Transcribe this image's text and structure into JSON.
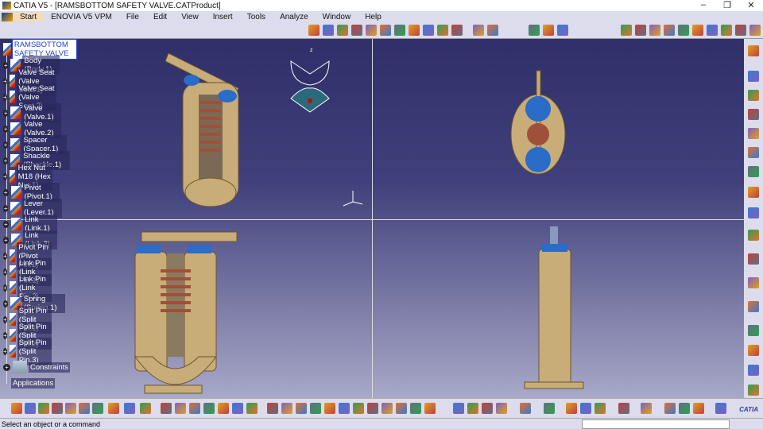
{
  "window": {
    "title": "CATIA V5 - [RAMSBOTTOM SAFETY VALVE.CATProduct]",
    "controls": [
      "–",
      "❐",
      "✕"
    ]
  },
  "menu": [
    "Start",
    "ENOVIA V5 VPM",
    "File",
    "Edit",
    "View",
    "Insert",
    "Tools",
    "Analyze",
    "Window",
    "Help"
  ],
  "tree": {
    "root": "RAMSBOTTOM SAFETY VALVE",
    "items": [
      "Body (Body.1)",
      "Valve Seat (Valve Seat.1)",
      "Valve Seat (Valve Seat.2)",
      "Valve (Valve.1)",
      "Valve (Valve.2)",
      "Spacer (Spacer.1)",
      "Shackle (Shackle.1)",
      "Hex Nut M18 (Hex Nut.1)",
      "Pivot (Pivot.1)",
      "Lever (Lever.1)",
      "Link (Link.1)",
      "Link (Link.2)",
      "Pivot Pin (Pivot Pin.1)",
      "Link Pin (Link Pin.1)",
      "Link Pin (Link Pin.2)",
      "Spring (Spring.1)",
      "Split Pin (Split Pin.1)",
      "Split Pin (Split Pin.2)",
      "Split Pin (Split Pin.3)"
    ],
    "constraints": "Constraints",
    "applications": "Applications"
  },
  "compass": {
    "z": "z",
    "x": "x",
    "y": "y"
  },
  "status": {
    "message": "Select an object or a command",
    "input_value": ""
  },
  "brand": "CATIA",
  "colors": {
    "part": "#c8ad78",
    "seat": "#2a6cc8",
    "spring": "#a0503a",
    "toolbar": "#dcdcec"
  }
}
